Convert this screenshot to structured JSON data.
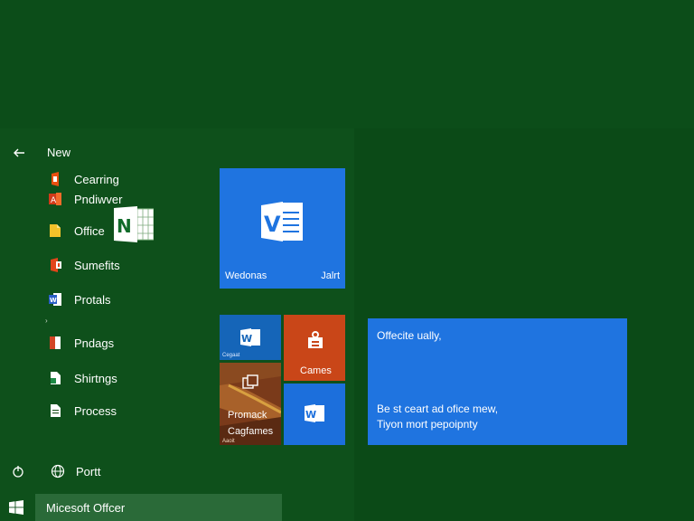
{
  "start_menu": {
    "header": {
      "label": "New"
    },
    "apps": [
      {
        "label": "Cearring",
        "icon": "office-orange-icon"
      },
      {
        "label": "Pndiwver",
        "icon": "access-red-icon"
      },
      {
        "label": "Office",
        "icon": "file-yellow-icon"
      },
      {
        "label": "Sumefits",
        "icon": "office-red-icon"
      },
      {
        "label": "Protals",
        "icon": "word-blue-icon"
      },
      {
        "label": "Pndags",
        "icon": "powerpoint-red-icon"
      },
      {
        "label": "Shirtngs",
        "icon": "excel-green-icon"
      },
      {
        "label": "Process",
        "icon": "document-icon"
      }
    ],
    "bottom": {
      "label": "Portt"
    }
  },
  "tiles": {
    "word": {
      "label_left": "Wedonas",
      "label_right": "Jalrt"
    },
    "small1": {
      "caption": "Cegaat"
    },
    "games": {
      "caption": "Cames"
    },
    "photo": {
      "caption1": "Promack",
      "caption2": "Cagfames",
      "caption3": "Aaoit"
    },
    "wide": {
      "line1": "Offecite ually,",
      "line2": "Be st ceart ad ofice mew,",
      "line3": "Tiyon mort pepoipnty"
    }
  },
  "taskbar": {
    "item_label": "Micesoft Offcer"
  },
  "colors": {
    "background": "#0d4f1a",
    "tile_blue": "#1f74e0",
    "tile_orange": "#c94618",
    "taskbar_highlight": "#2a6a38"
  }
}
